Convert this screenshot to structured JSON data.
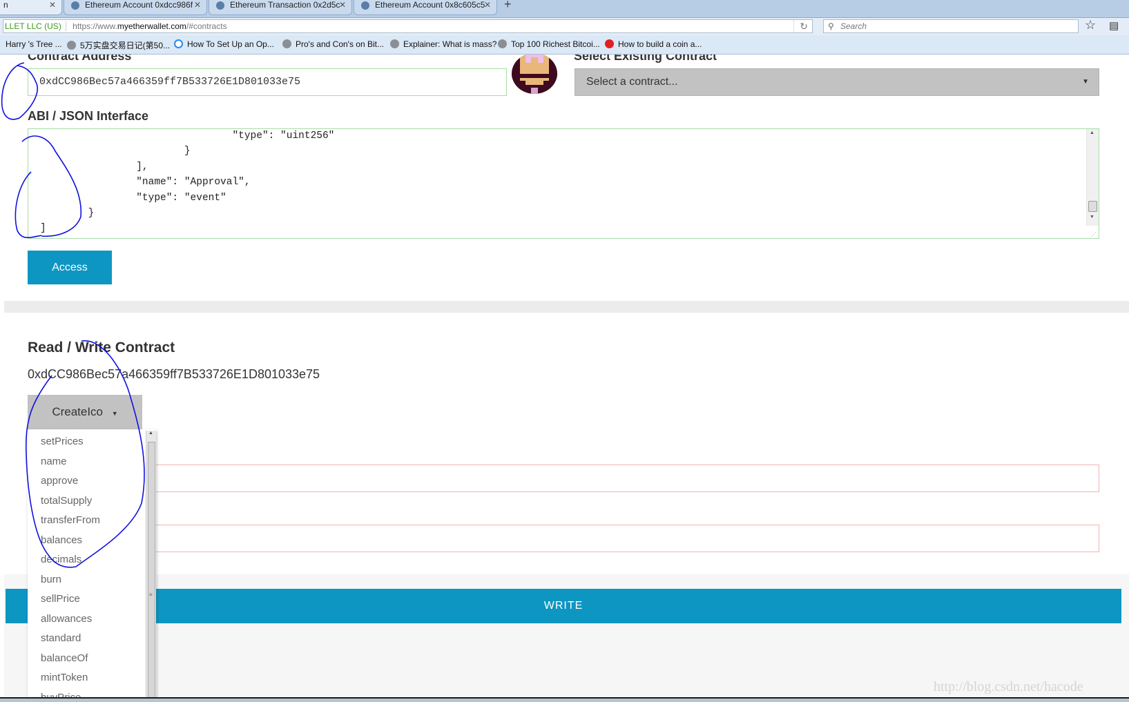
{
  "browser": {
    "tabs": [
      {
        "label": "n"
      },
      {
        "label": "Ethereum Account 0xdcc986f"
      },
      {
        "label": "Ethereum Transaction 0x2d5c"
      },
      {
        "label": "Ethereum Account 0x8c605c5"
      }
    ],
    "site_identity": "LLET LLC (US)",
    "url_prefix": "https://www.",
    "url_domain": "myetherwallet.com",
    "url_suffix": "/#contracts",
    "search_placeholder": "Search",
    "bookmarks": [
      "Harry 's Tree ...",
      "5万实盘交易日记(第50...",
      "How To Set Up an Op...",
      "Pro's and Con's on Bit...",
      "Explainer: What is mass?",
      "Top 100 Richest Bitcoi...",
      "How to build a coin a..."
    ]
  },
  "access": {
    "contract_address_label": "Contract Address",
    "contract_address_value": "0xdCC986Bec57a466359ff7B533726E1D801033e75",
    "select_existing_label": "Select Existing Contract",
    "select_placeholder": "Select a contract...",
    "abi_label": "ABI / JSON Interface",
    "abi_lines": [
      "                                \"type\": \"uint256\"",
      "                        }",
      "                ],",
      "                \"name\": \"Approval\",",
      "                \"type\": \"event\"",
      "        }",
      "]"
    ],
    "access_button": "Access"
  },
  "read_write": {
    "title": "Read / Write Contract",
    "address": "0xdCC986Bec57a466359ff7B533726E1D801033e75",
    "function_selected": "CreateIco",
    "functions": [
      "setPrices",
      "name",
      "approve",
      "totalSupply",
      "transferFrom",
      "balances",
      "decimals",
      "burn",
      "sellPrice",
      "allowances",
      "standard",
      "balanceOf",
      "mintToken",
      "buyPrice"
    ],
    "write_button": "WRITE"
  },
  "watermark": "http://blog.csdn.net/hacode",
  "colors": {
    "accent": "#0e96c2",
    "annotation": "#1010e0"
  }
}
